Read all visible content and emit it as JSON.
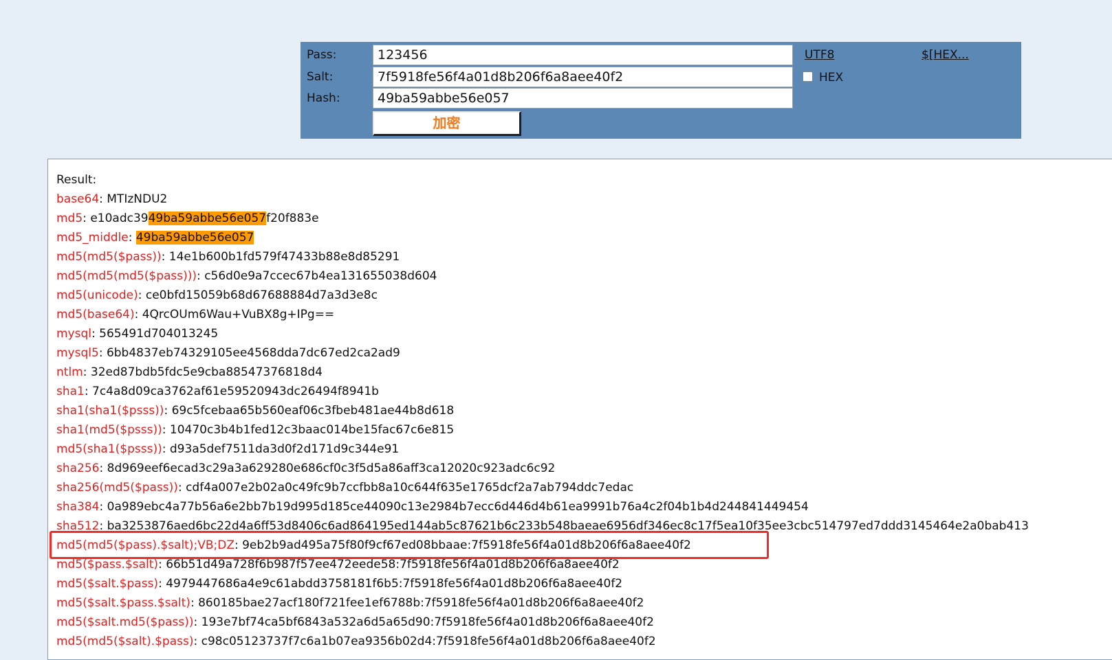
{
  "form": {
    "pass_label": "Pass:",
    "pass_value": "123456",
    "salt_label": "Salt:",
    "salt_value": "7f5918fe56f4a01d8b206f6a8aee40f2",
    "hash_label": "Hash:",
    "hash_value": "49ba59abbe56e057",
    "encrypt_label": "加密",
    "utf8_link": "UTF8",
    "hex_link": "$[HEX...",
    "hex_label": "HEX",
    "hex_checked": false
  },
  "result": {
    "heading": "Result:",
    "base64": {
      "key": "base64",
      "value": "MTIzNDU2"
    },
    "md5": {
      "key": "md5",
      "prefix": "e10adc39",
      "match": "49ba59abbe56e057",
      "suffix": "f20f883e"
    },
    "md5_middle": {
      "key": "md5_middle",
      "value": "49ba59abbe56e057"
    },
    "rows": [
      {
        "key": "md5(md5($pass))",
        "value": "14e1b600b1fd579f47433b88e8d85291"
      },
      {
        "key": "md5(md5(md5($pass)))",
        "value": "c56d0e9a7ccec67b4ea131655038d604"
      },
      {
        "key": "md5(unicode)",
        "value": "ce0bfd15059b68d67688884d7a3d3e8c"
      },
      {
        "key": "md5(base64)",
        "value": "4QrcOUm6Wau+VuBX8g+IPg=="
      },
      {
        "key": "mysql",
        "value": "565491d704013245"
      },
      {
        "key": "mysql5",
        "value": "6bb4837eb74329105ee4568dda7dc67ed2ca2ad9"
      },
      {
        "key": "ntlm",
        "value": "32ed87bdb5fdc5e9cba88547376818d4"
      },
      {
        "key": "sha1",
        "value": "7c4a8d09ca3762af61e59520943dc26494f8941b"
      },
      {
        "key": "sha1(sha1($psss))",
        "value": "69c5fcebaa65b560eaf06c3fbeb481ae44b8d618"
      },
      {
        "key": "sha1(md5($psss))",
        "value": "10470c3b4b1fed12c3baac014be15fac67c6e815"
      },
      {
        "key": "md5(sha1($psss))",
        "value": "d93a5def7511da3d0f2d171d9c344e91"
      },
      {
        "key": "sha256",
        "value": "8d969eef6ecad3c29a3a629280e686cf0c3f5d5a86aff3ca12020c923adc6c92"
      },
      {
        "key": "sha256(md5($pass))",
        "value": "cdf4a007e2b02a0c49fc9b7ccfbb8a10c644f635e1765dcf2a7ab794ddc7edac"
      },
      {
        "key": "sha384",
        "value": "0a989ebc4a77b56a6e2bb7b19d995d185ce44090c13e2984b7ecc6d446d4b61ea9991b76a4c2f04b1b4d244841449454"
      },
      {
        "key": "sha512",
        "value": "ba3253876aed6bc22d4a6ff53d8406c6ad864195ed144ab5c87621b6c233b548baeae6956df346ec8c17f5ea10f35ee3cbc514797ed7ddd3145464e2a0bab413"
      },
      {
        "key": "md5(md5($pass).$salt);VB;DZ",
        "value": "9eb2b9ad495a75f80f9cf67ed08bbaae:7f5918fe56f4a01d8b206f6a8aee40f2"
      },
      {
        "key": "md5($pass.$salt)",
        "value": "66b51d49a728f6b987f57ee472eede58:7f5918fe56f4a01d8b206f6a8aee40f2"
      },
      {
        "key": "md5($salt.$pass)",
        "value": "4979447686a4e9c61abdd3758181f6b5:7f5918fe56f4a01d8b206f6a8aee40f2"
      },
      {
        "key": "md5($salt.$pass.$salt)",
        "value": "860185bae27acf180f721fee1ef6788b:7f5918fe56f4a01d8b206f6a8aee40f2"
      },
      {
        "key": "md5($salt.md5($pass))",
        "value": "193e7bf74ca5bf6843a532a6d5a65d90:7f5918fe56f4a01d8b206f6a8aee40f2"
      },
      {
        "key": "md5(md5($salt).$pass)",
        "value": "c98c05123737f7c6a1b07ea9356b02d4:7f5918fe56f4a01d8b206f6a8aee40f2"
      }
    ]
  },
  "colors": {
    "page_bg": "#e6eff8",
    "panel_bg": "#5b88b5",
    "key_red": "#e0201e",
    "match_orange": "#ff9a00",
    "button_text": "#f47a1f",
    "frame_red": "#ee2b25"
  }
}
